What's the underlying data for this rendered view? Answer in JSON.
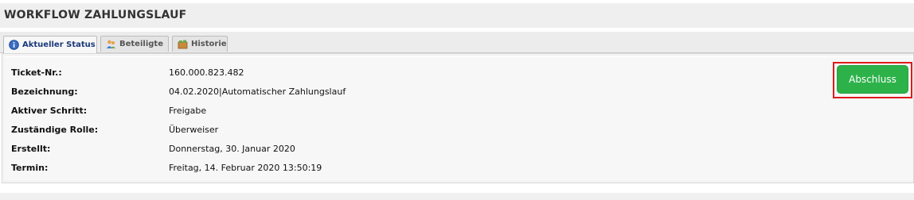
{
  "header": {
    "title": "WORKFLOW ZAHLUNGSLAUF"
  },
  "tabs": [
    {
      "label": "Aktueller Status",
      "icon": "info-icon",
      "active": true
    },
    {
      "label": "Beteiligte",
      "icon": "people-icon",
      "active": false
    },
    {
      "label": "Historie",
      "icon": "history-icon",
      "active": false
    }
  ],
  "details": {
    "ticket": {
      "label": "Ticket-Nr.:",
      "value": "160.000.823.482"
    },
    "bezeichnung": {
      "label": "Bezeichnung:",
      "value": "04.02.2020|Automatischer Zahlungslauf"
    },
    "schritt": {
      "label": "Aktiver Schritt:",
      "value": "Freigabe"
    },
    "rolle": {
      "label": "Zuständige Rolle:",
      "value": "Überweiser"
    },
    "erstellt": {
      "label": "Erstellt:",
      "value": "Donnerstag, 30. Januar 2020"
    },
    "termin": {
      "label": "Termin:",
      "value": "Freitag, 14. Februar 2020 13:50:19"
    }
  },
  "actions": {
    "abschluss_label": "Abschluss"
  },
  "colors": {
    "accent": "#2db24a",
    "highlight": "#e01b1b",
    "tab_active_text": "#1a3a7a"
  }
}
